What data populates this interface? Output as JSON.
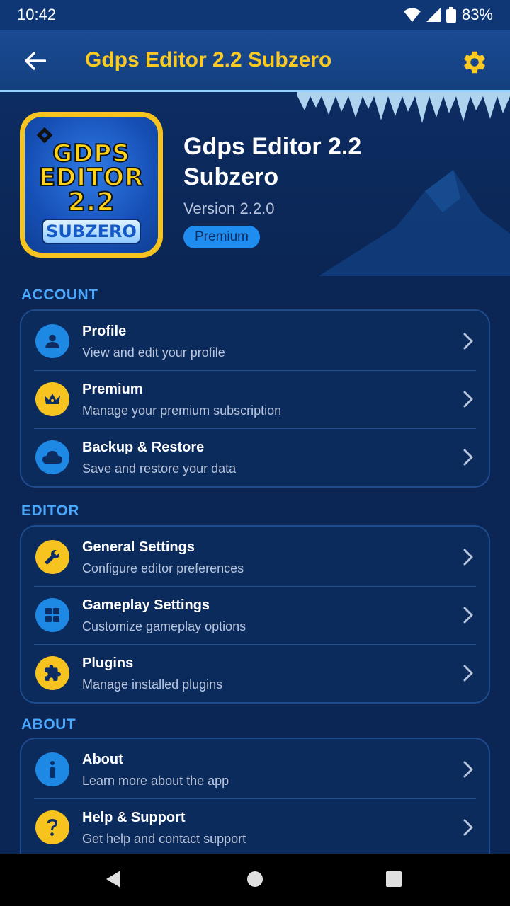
{
  "status_bar": {
    "time": "10:42",
    "battery": "83%"
  },
  "app_bar": {
    "title": "Gdps Editor 2.2 Subzero",
    "back_icon": "arrow-left-icon",
    "settings_icon": "gear-icon"
  },
  "header": {
    "app_name": "Gdps Editor 2.2 Subzero",
    "version": "Version 2.2.0",
    "badge": "Premium",
    "logo": {
      "line1": "GDPS",
      "line2": "EDITOR",
      "line3": "2.2",
      "line4": "SUBZERO"
    }
  },
  "sections": {
    "account": {
      "label": "ACCOUNT",
      "items": [
        {
          "title": "Profile",
          "subtitle": "View and edit your profile",
          "icon": "user-icon"
        },
        {
          "title": "Premium",
          "subtitle": "Manage your premium subscription",
          "icon": "crown-icon"
        },
        {
          "title": "Backup & Restore",
          "subtitle": "Save and restore your data",
          "icon": "cloud-icon"
        }
      ]
    },
    "editor": {
      "label": "EDITOR",
      "items": [
        {
          "title": "General Settings",
          "subtitle": "Configure editor preferences",
          "icon": "wrench-icon"
        },
        {
          "title": "Gameplay Settings",
          "subtitle": "Customize gameplay options",
          "icon": "grid-icon"
        },
        {
          "title": "Plugins",
          "subtitle": "Manage installed plugins",
          "icon": "puzzle-icon"
        }
      ]
    },
    "about": {
      "label": "ABOUT",
      "items": [
        {
          "title": "About",
          "subtitle": "Learn more about the app",
          "icon": "info-icon"
        },
        {
          "title": "Help & Support",
          "subtitle": "Get help and contact support",
          "icon": "question-icon"
        }
      ]
    }
  },
  "colors": {
    "background": "#0b2654",
    "accent_yellow": "#f9c924",
    "accent_blue": "#1e88e5",
    "section_label": "#4aa8ff"
  }
}
